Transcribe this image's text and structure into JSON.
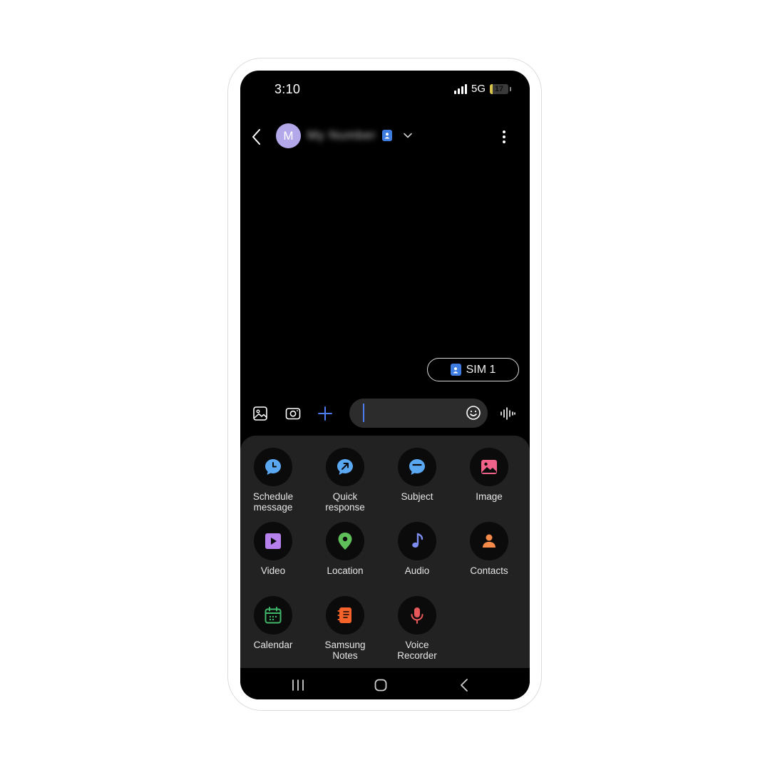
{
  "status_bar": {
    "time": "3:10",
    "network": "5G",
    "battery": "17",
    "battery_level": 0.17
  },
  "header": {
    "avatar_initial": "M",
    "contact_name": "My Number"
  },
  "sim_button": {
    "label": "SIM 1"
  },
  "compose": {
    "placeholder": "",
    "accent": "#4d7cf0"
  },
  "attachments": [
    {
      "label": "Schedule\nmessage",
      "icon": "schedule-clock-icon",
      "color": "#5aa7f2"
    },
    {
      "label": "Quick\nresponse",
      "icon": "quick-response-icon",
      "color": "#5aa7f2"
    },
    {
      "label": "Subject",
      "icon": "subject-icon",
      "color": "#5aa7f2"
    },
    {
      "label": "Image",
      "icon": "image-icon",
      "color": "#f0628a"
    },
    {
      "label": "Video",
      "icon": "video-icon",
      "color": "#b681ec"
    },
    {
      "label": "Location",
      "icon": "location-pin-icon",
      "color": "#5fbf5a"
    },
    {
      "label": "Audio",
      "icon": "music-note-icon",
      "color": "#7d8df0"
    },
    {
      "label": "Contacts",
      "icon": "contact-person-icon",
      "color": "#f58a4a"
    },
    {
      "label": "Calendar",
      "icon": "calendar-icon",
      "color": "#3fb86a"
    },
    {
      "label": "Samsung\nNotes",
      "icon": "notes-icon",
      "color": "#f5622a"
    },
    {
      "label": "Voice\nRecorder",
      "icon": "microphone-icon",
      "color": "#e8575a"
    }
  ]
}
